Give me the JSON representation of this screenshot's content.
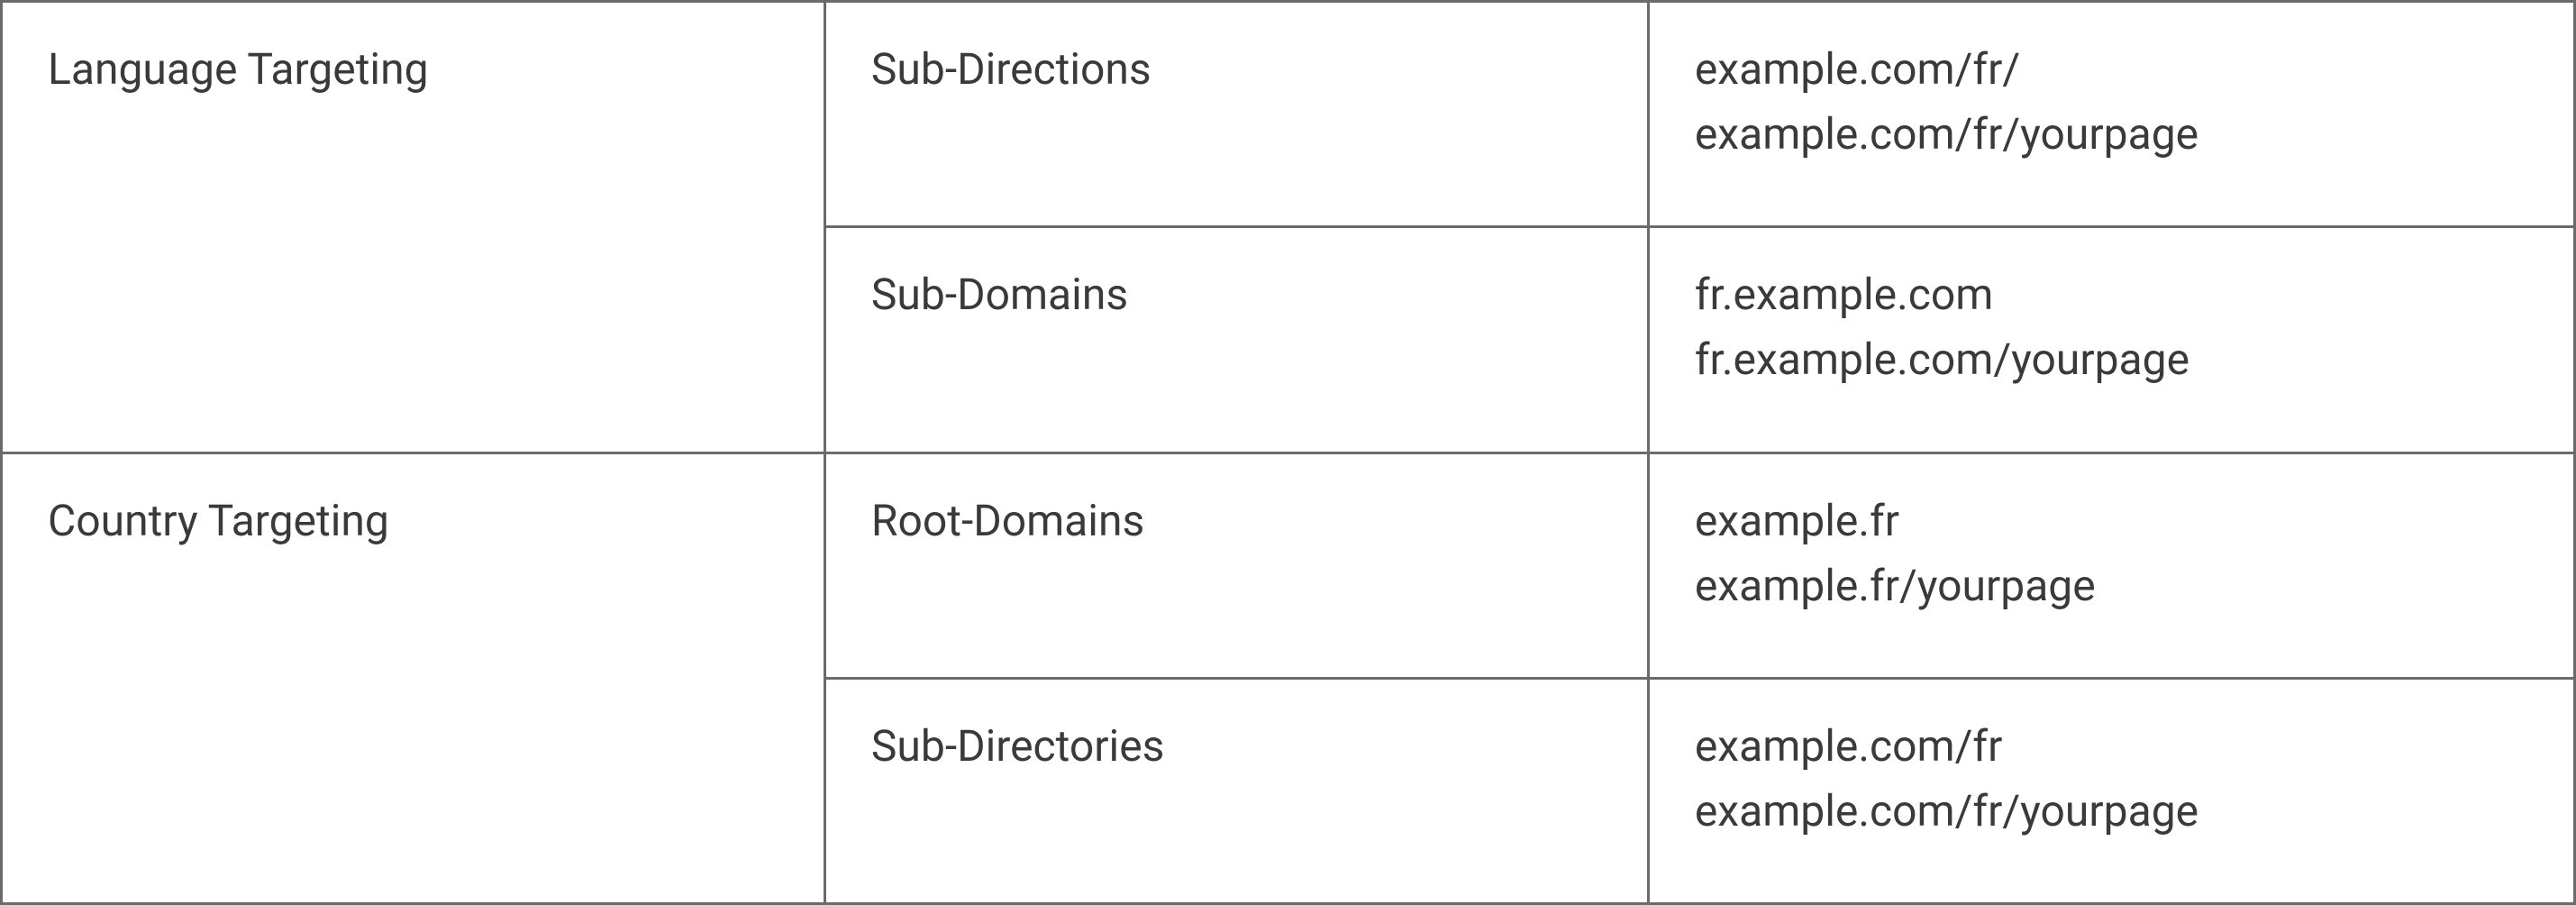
{
  "rows": [
    {
      "category": "Language Targeting",
      "methods": [
        {
          "name": "Sub-Directions",
          "example1": "example.com/fr/",
          "example2": "example.com/fr/yourpage"
        },
        {
          "name": "Sub-Domains",
          "example1": "fr.example.com",
          "example2": "fr.example.com/yourpage"
        }
      ]
    },
    {
      "category": "Country Targeting",
      "methods": [
        {
          "name": "Root-Domains",
          "example1": "example.fr",
          "example2": "example.fr/yourpage"
        },
        {
          "name": "Sub-Directories",
          "example1": "example.com/fr",
          "example2": "example.com/fr/yourpage"
        }
      ]
    }
  ]
}
